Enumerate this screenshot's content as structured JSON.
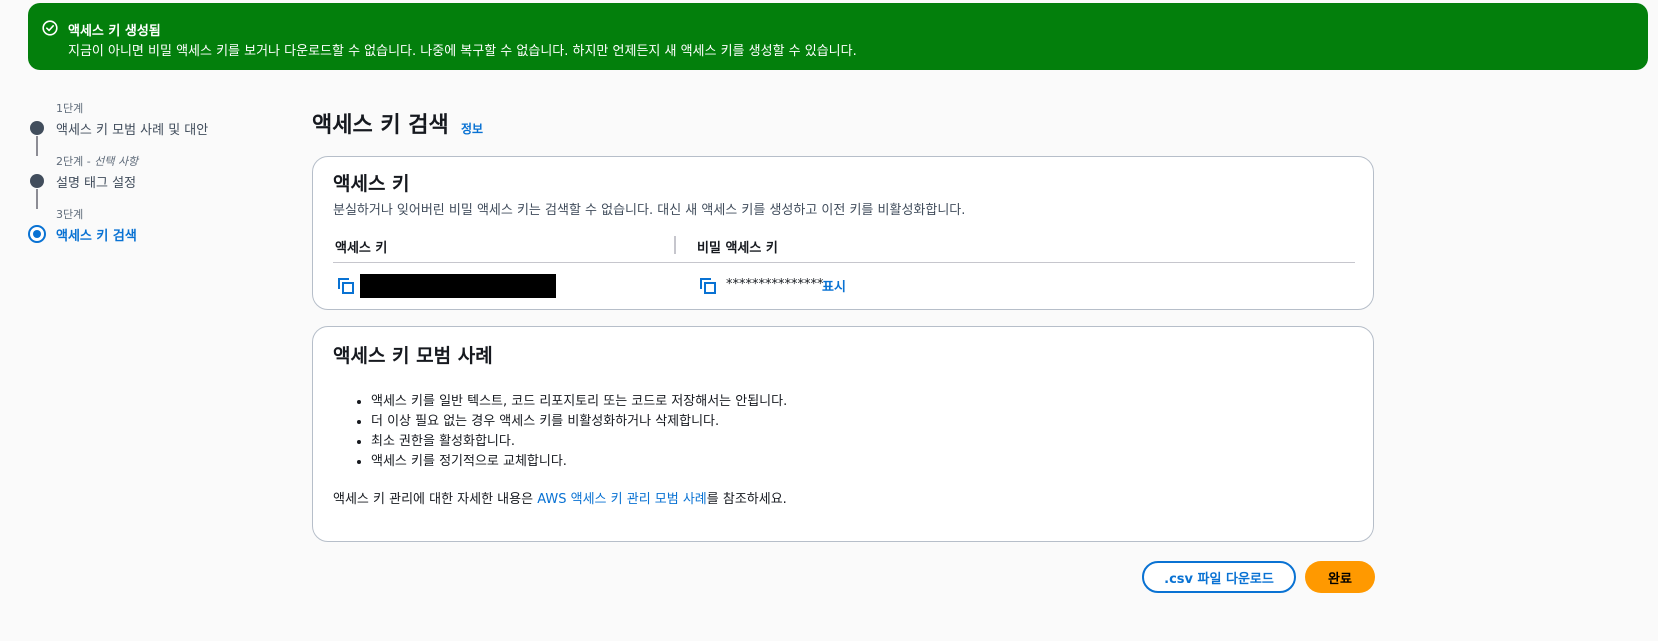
{
  "flash": {
    "title": "액세스 키 생성됨",
    "message": "지금이 아니면 비밀 액세스 키를 보거나 다운로드할 수 없습니다. 나중에 복구할 수 없습니다. 하지만 언제든지 새 액세스 키를 생성할 수 있습니다.",
    "color": "#037f0c"
  },
  "steps": [
    {
      "label": "1단계",
      "title": "액세스 키 모범 사례 및 대안"
    },
    {
      "label": "2단계 - ",
      "optional": "선택 사항",
      "title": "설명 태그 설정"
    },
    {
      "label": "3단계",
      "title": "액세스 키 검색"
    }
  ],
  "page": {
    "title": "액세스 키 검색",
    "info_link": "정보"
  },
  "access_key_card": {
    "title": "액세스 키",
    "description": "분실하거나 잊어버린 비밀 액세스 키는 검색할 수 없습니다. 대신 새 액세스 키를 생성하고 이전 키를 비활성화합니다.",
    "columns": [
      "액세스 키",
      "비밀 액세스 키"
    ],
    "secret_masked": "***************",
    "show_label": "표시"
  },
  "best_practices_card": {
    "title": "액세스 키 모범 사례",
    "items": [
      "액세스 키를 일반 텍스트, 코드 리포지토리 또는 코드로 저장해서는 안됩니다.",
      "더 이상 필요 없는 경우 액세스 키를 비활성화하거나 삭제합니다.",
      "최소 권한을 활성화합니다.",
      "액세스 키를 정기적으로 교체합니다."
    ],
    "note_prefix": "액세스 키 관리에 대한 자세한 내용은 ",
    "note_link": "AWS 액세스 키 관리 모범 사례",
    "note_suffix": "를 참조하세요."
  },
  "buttons": {
    "download_csv": ".csv 파일 다운로드",
    "done": "완료"
  },
  "colors": {
    "accent": "#0972d3",
    "primary_button": "#ff9900"
  }
}
